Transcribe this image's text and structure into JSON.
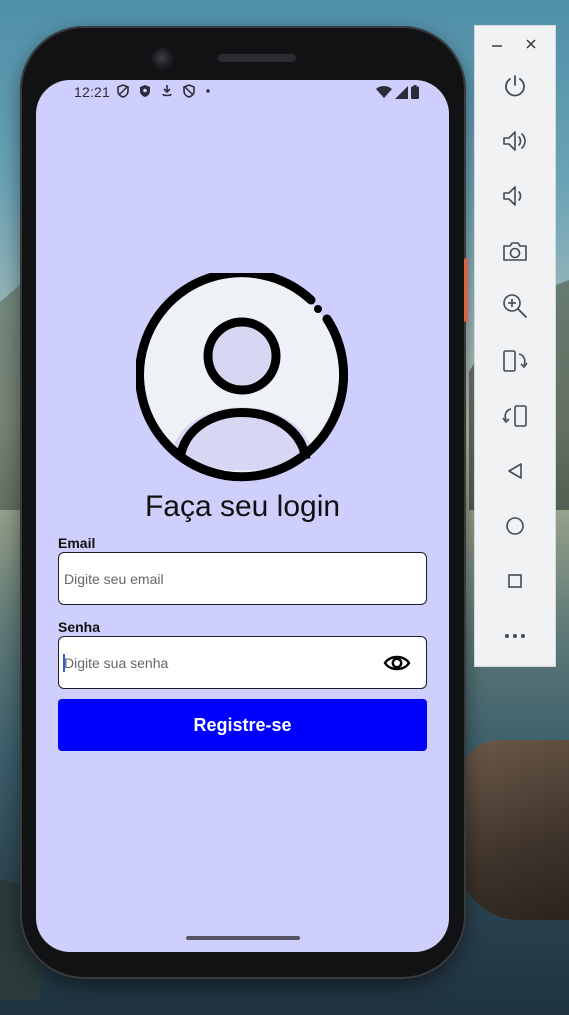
{
  "status_bar": {
    "time": "12:21"
  },
  "login": {
    "title": "Faça seu login",
    "email": {
      "label": "Email",
      "placeholder": "Digite seu email",
      "value": ""
    },
    "senha": {
      "label": "Senha",
      "placeholder": "Digite sua senha",
      "value": ""
    },
    "register_label": "Registre-se"
  },
  "colors": {
    "screen_background": "#cfcffd",
    "button_primary": "#0000ff",
    "button_text": "#ffffff"
  },
  "emulator_toolbar": {
    "window_controls": [
      "minimize-icon",
      "close-icon"
    ],
    "buttons": [
      "power-icon",
      "volume-up-icon",
      "volume-down-icon",
      "camera-icon",
      "zoom-in-icon",
      "rotate-left-icon",
      "rotate-right-icon",
      "back-icon",
      "home-icon",
      "overview-icon",
      "more-icon"
    ]
  }
}
